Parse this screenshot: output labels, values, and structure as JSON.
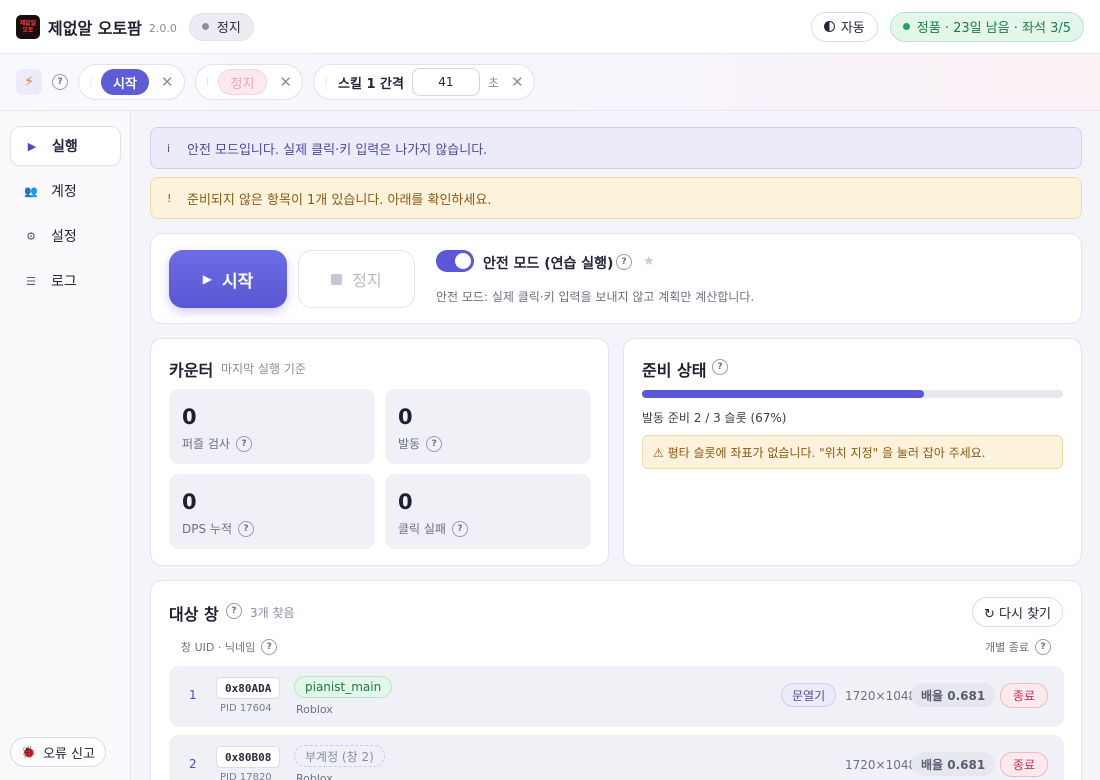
{
  "header": {
    "logo_text_1": "제없알",
    "logo_text_2": "오토",
    "title": "제없알 오토팜",
    "version": "2.0.0",
    "status": "정지",
    "theme_label": "자동",
    "license": "정품 · 23일 남음 · 좌석 3/5"
  },
  "toolbar": {
    "help": "?",
    "start_chip": "시작",
    "stop_chip": "정지",
    "skill_label": "스킬 1 간격",
    "skill_value": "41",
    "skill_unit": "초",
    "close_glyph": "✕"
  },
  "sidebar": {
    "items": [
      {
        "label": "실행",
        "icon": "play-icon"
      },
      {
        "label": "계정",
        "icon": "users-icon"
      },
      {
        "label": "설정",
        "icon": "gear-icon"
      },
      {
        "label": "로그",
        "icon": "list-icon"
      }
    ],
    "bug_report": "오류 신고"
  },
  "banners": {
    "info_mark": "i",
    "info": "안전 모드입니다. 실제 클릭·키 입력은 나가지 않습니다.",
    "warn_mark": "!",
    "warn": "준비되지 않은 항목이 1개 있습니다. 아래를 확인하세요."
  },
  "run": {
    "start": "시작",
    "stop": "정지",
    "safe_mode_title": "안전 모드 (연습 실행)",
    "safe_mode_on": true,
    "safe_mode_desc": "안전 모드: 실제 클릭·키 입력을 보내지 않고 계획만 계산합니다."
  },
  "counter": {
    "title": "카운터",
    "subtitle": "마지막 실행 기준",
    "stats": [
      {
        "value": "0",
        "label": "퍼즐 검사"
      },
      {
        "value": "0",
        "label": "발동"
      },
      {
        "value": "0",
        "label": "DPS 누적"
      },
      {
        "value": "0",
        "label": "클릭 실패"
      }
    ]
  },
  "ready": {
    "title": "준비 상태",
    "progress": 0.67,
    "text": "발동 준비 2 / 3 슬롯 (67%)",
    "warning": "⚠ 평타 슬롯에 좌표가 없습니다. \"위치 지정\" 을 눌러 잡아 주세요."
  },
  "targets": {
    "title": "대상 창",
    "found": "3개 찾음",
    "refresh": "↻ 다시 찾기",
    "col_uid": "창 UID · 닉네임",
    "col_close": "개별 종료",
    "rows": [
      {
        "index": "1",
        "uid": "0x80ADA",
        "pid": "PID 17604",
        "nick": "pianist_main",
        "process": "Roblox",
        "role": "문열기",
        "size": "1720×1048",
        "scale": "배율 0.681",
        "close": "종료"
      },
      {
        "index": "2",
        "uid": "0x80B08",
        "pid": "PID 17820",
        "nick": "부계정 (창 2)",
        "process": "Roblox",
        "role": "",
        "size": "1720×1048",
        "scale": "배율 0.681",
        "close": "종료"
      }
    ]
  },
  "colors": {
    "accent": "#5a58d6",
    "success": "#23a55a",
    "warning": "#8a5a12",
    "danger": "#c23452"
  }
}
